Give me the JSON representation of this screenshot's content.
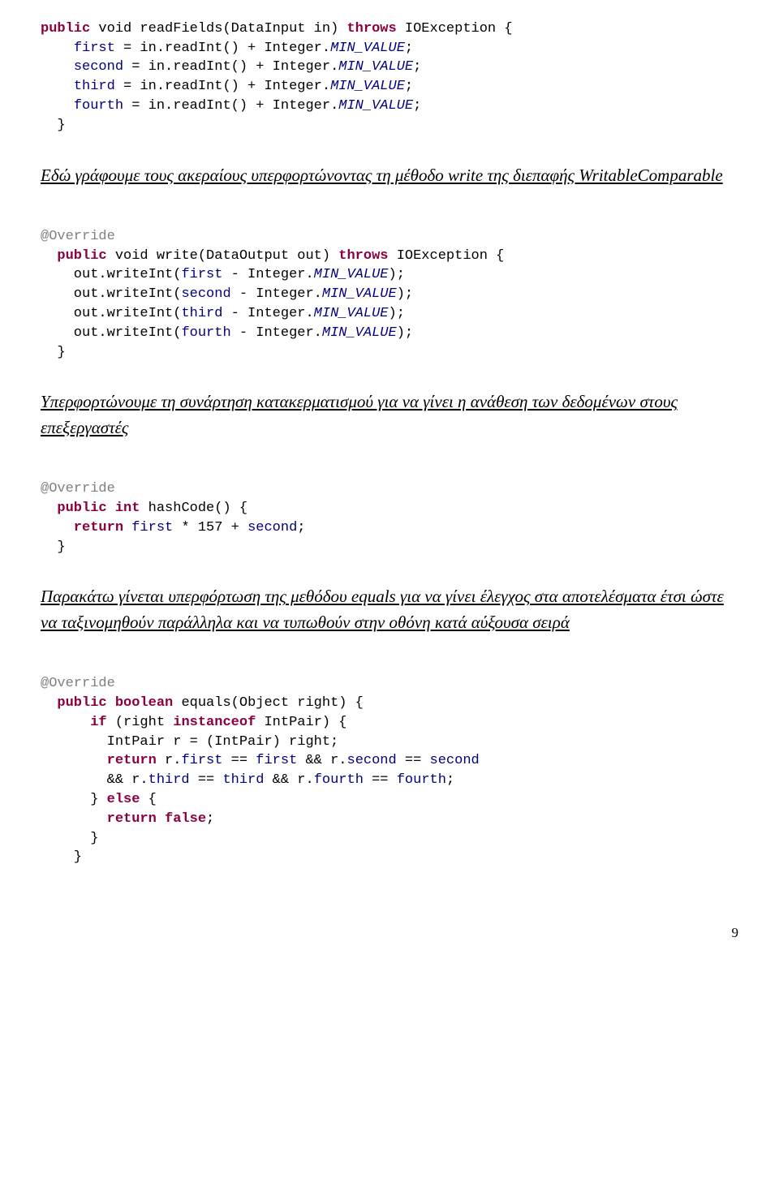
{
  "code1": {
    "l1a": "public",
    "l1b": " void",
    "l1c": " readFields(DataInput in) ",
    "l1d": "throws",
    "l1e": " IOException {",
    "l2a": "    ",
    "l2b": "first",
    "l2c": " = in.readInt() + Integer.",
    "l2d": "MIN_VALUE",
    "l2e": ";",
    "l3a": "    ",
    "l3b": "second",
    "l3c": " = in.readInt() + Integer.",
    "l3d": "MIN_VALUE",
    "l3e": ";",
    "l4a": "    ",
    "l4b": "third",
    "l4c": " = in.readInt() + Integer.",
    "l4d": "MIN_VALUE",
    "l4e": ";",
    "l5a": "    ",
    "l5b": "fourth",
    "l5c": " = in.readInt() + Integer.",
    "l5d": "MIN_VALUE",
    "l5e": ";",
    "l6": "  }"
  },
  "heading1": "Εδώ γράφουμε τους ακεραίους υπερφορτώνοντας τη μέθοδο write της διεπαφής WritableComparable",
  "code2": {
    "l1": "@Override",
    "l2a": "  public",
    "l2b": " void",
    "l2c": " write(DataOutput out) ",
    "l2d": "throws",
    "l2e": " IOException {",
    "l3a": "    out.writeInt(",
    "l3b": "first",
    "l3c": " - Integer.",
    "l3d": "MIN_VALUE",
    "l3e": ");",
    "l4a": "    out.writeInt(",
    "l4b": "second",
    "l4c": " - Integer.",
    "l4d": "MIN_VALUE",
    "l4e": ");",
    "l5a": "    out.writeInt(",
    "l5b": "third",
    "l5c": " - Integer.",
    "l5d": "MIN_VALUE",
    "l5e": ");",
    "l6a": "    out.writeInt(",
    "l6b": "fourth",
    "l6c": " - Integer.",
    "l6d": "MIN_VALUE",
    "l6e": ");",
    "l7": "  }"
  },
  "heading2": "Υπερφορτώνουμε τη συνάρτηση κατακερματισμού για να γίνει η ανάθεση των δεδομένων στους επεξεργαστές",
  "code3": {
    "l1": "@Override",
    "l2a": "  public",
    "l2b": " int",
    "l2c": " hashCode() {",
    "l3a": "    return",
    "l3b": " ",
    "l3c": "first",
    "l3d": " * 157 + ",
    "l3e": "second",
    "l3f": ";",
    "l4": "  }"
  },
  "heading3": "Παρακάτω γίνεται υπερφόρτωση της μεθόδου equals για να γίνει έλεγχος στα αποτελέσματα έτσι ώστε να ταξινομηθούν παράλληλα και να τυπωθούν στην οθόνη κατά αύξουσα σειρά",
  "code4": {
    "l1": "@Override",
    "l2a": "  public",
    "l2b": " boolean",
    "l2c": " equals(Object right) {",
    "l3a": "      if",
    "l3b": " (right ",
    "l3c": "instanceof",
    "l3d": " IntPair) {",
    "l4": "        IntPair r = (IntPair) right;",
    "l5a": "        return",
    "l5b": " r.",
    "l5c": "first",
    "l5d": " == ",
    "l5e": "first",
    "l5f": " && r.",
    "l5g": "second",
    "l5h": " == ",
    "l5i": "second",
    "l6a": "        && r.",
    "l6b": "third",
    "l6c": " == ",
    "l6d": "third",
    "l6e": " && r.",
    "l6f": "fourth",
    "l6g": " == ",
    "l6h": "fourth",
    "l6i": ";",
    "l7a": "      } ",
    "l7b": "else",
    "l7c": " {",
    "l8a": "        return",
    "l8b": " ",
    "l8c": "false",
    "l8d": ";",
    "l9": "      }",
    "l10": "    }"
  },
  "pagenum": "9"
}
